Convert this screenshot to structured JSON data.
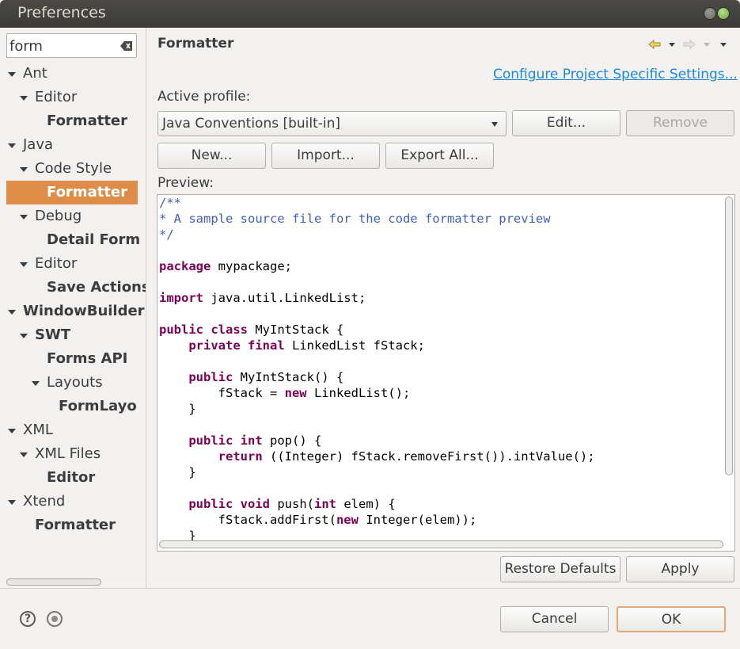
{
  "window": {
    "title": "Preferences"
  },
  "filter": {
    "value": "form"
  },
  "tree": [
    {
      "label": "Ant",
      "bold": false
    },
    {
      "label": "Editor",
      "bold": false
    },
    {
      "label": "Formatter",
      "bold": true
    },
    {
      "label": "Java",
      "bold": false
    },
    {
      "label": "Code Style",
      "bold": false
    },
    {
      "label": "Formatter",
      "bold": true,
      "selected": true
    },
    {
      "label": "Debug",
      "bold": false
    },
    {
      "label": "Detail Forma",
      "bold": true
    },
    {
      "label": "Editor",
      "bold": false
    },
    {
      "label": "Save Actions",
      "bold": true
    },
    {
      "label": "WindowBuilder",
      "bold": true
    },
    {
      "label": "SWT",
      "bold": true
    },
    {
      "label": "Forms API",
      "bold": true
    },
    {
      "label": "Layouts",
      "bold": false
    },
    {
      "label": "FormLayout",
      "bold": true
    },
    {
      "label": "XML",
      "bold": false
    },
    {
      "label": "XML Files",
      "bold": false
    },
    {
      "label": "Editor",
      "bold": true
    },
    {
      "label": "Xtend",
      "bold": false
    },
    {
      "label": "Formatter",
      "bold": true
    }
  ],
  "page": {
    "title": "Formatter",
    "project_link": "Configure Project Specific Settings...",
    "active_profile_label": "Active profile:",
    "profile_value": "Java Conventions [built-in]",
    "edit_button": "Edit...",
    "remove_button": "Remove",
    "new_button": "New...",
    "import_button": "Import...",
    "export_button": "Export All...",
    "preview_label": "Preview:",
    "restore_button": "Restore Defaults",
    "apply_button": "Apply"
  },
  "code_lines": [
    "/**",
    "* A sample source file for the code formatter preview",
    "*/",
    "",
    "package mypackage;",
    "",
    "import java.util.LinkedList;",
    "",
    "public class MyIntStack {",
    "    private final LinkedList fStack;",
    "",
    "    public MyIntStack() {",
    "        fStack = new LinkedList();",
    "    }",
    "",
    "    public int pop() {",
    "        return ((Integer) fStack.removeFirst()).intValue();",
    "    }",
    "",
    "    public void push(int elem) {",
    "        fStack.addFirst(new Integer(elem));",
    "    }"
  ],
  "dialog": {
    "cancel_button": "Cancel",
    "ok_button": "OK"
  },
  "colors": {
    "selection": "#dd8d48",
    "link": "#1a8ad8",
    "keyword": "#7f0055",
    "comment": "#3f5fbf"
  },
  "icons": [
    "clear-filter-icon",
    "back-icon",
    "forward-icon",
    "menu-icon",
    "help-icon",
    "record-icon"
  ]
}
